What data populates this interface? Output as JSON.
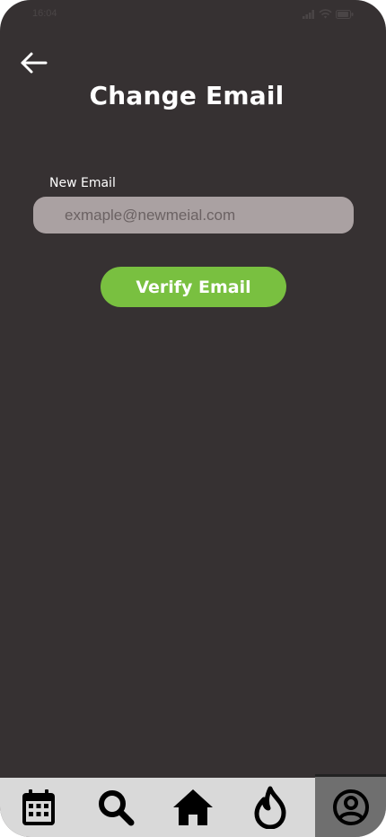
{
  "status_bar": {
    "time": "16:04",
    "icons": [
      "signal-icon",
      "wifi-icon",
      "battery-icon"
    ]
  },
  "header": {
    "back_icon": "arrow-left-icon",
    "title": "Change Email"
  },
  "form": {
    "email_label": "New Email",
    "email_value": "",
    "email_placeholder": "exmaple@newmeial.com",
    "verify_label": "Verify Email"
  },
  "bottom_nav": {
    "items": [
      {
        "icon": "calendar-icon",
        "active": false
      },
      {
        "icon": "search-icon",
        "active": false
      },
      {
        "icon": "home-icon",
        "active": false
      },
      {
        "icon": "flame-icon",
        "active": false
      },
      {
        "icon": "profile-icon",
        "active": true
      }
    ]
  },
  "colors": {
    "background": "#363132",
    "input_background": "#aaa1a2",
    "accent": "#79c040",
    "nav_background": "#d9d9d9",
    "nav_active": "#6f6f6f"
  }
}
